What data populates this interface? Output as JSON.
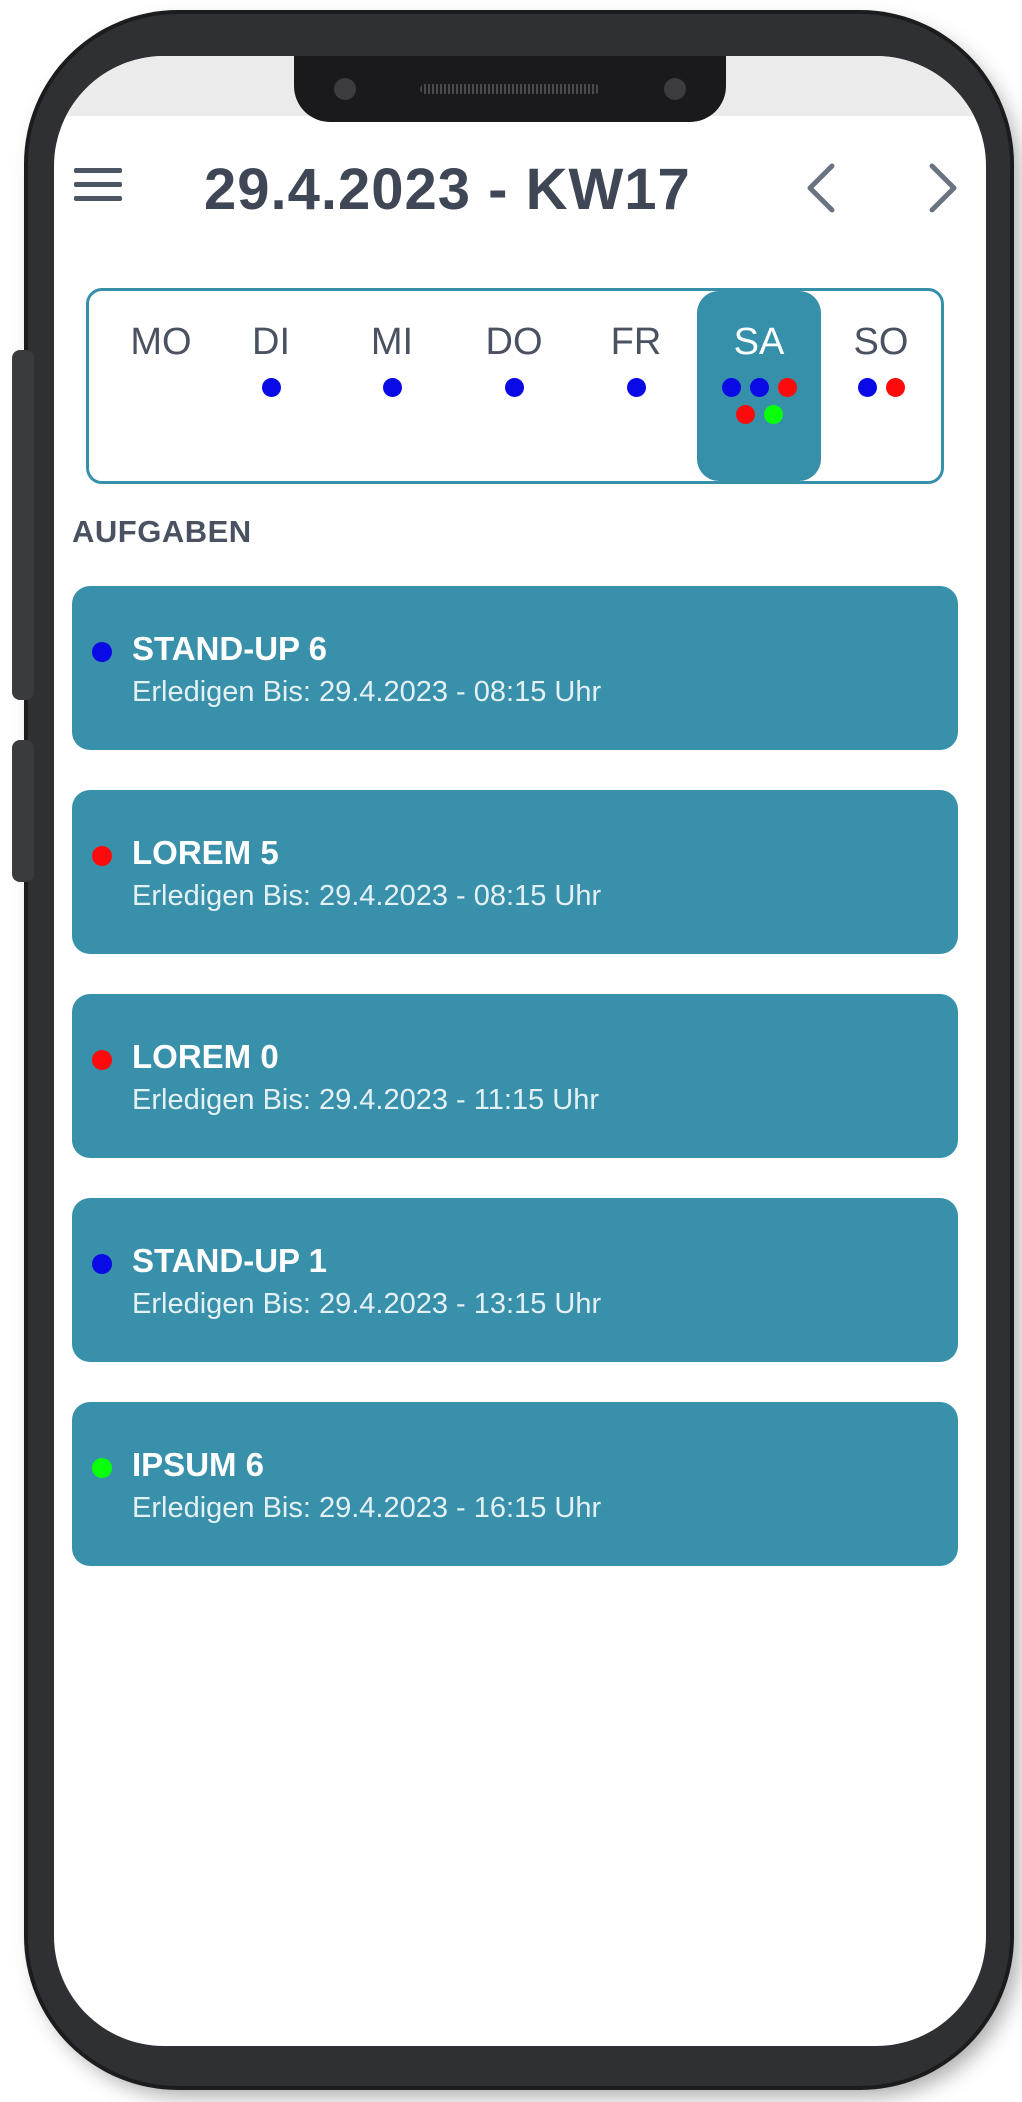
{
  "header": {
    "title": "29.4.2023 - KW17",
    "menu_icon": "hamburger-menu-icon",
    "prev_icon": "chevron-left-icon",
    "next_icon": "chevron-right-icon"
  },
  "week": {
    "selected": "SA",
    "days": [
      {
        "label": "MO",
        "dots": []
      },
      {
        "label": "DI",
        "dots": [
          "#0a0ae6"
        ]
      },
      {
        "label": "MI",
        "dots": [
          "#0a0ae6"
        ]
      },
      {
        "label": "DO",
        "dots": [
          "#0a0ae6"
        ]
      },
      {
        "label": "FR",
        "dots": [
          "#0a0ae6"
        ]
      },
      {
        "label": "SA",
        "dots": [
          "#0a0ae6",
          "#0a0ae6",
          "#ff0a0a",
          "#ff0a0a",
          "#0aff0a"
        ]
      },
      {
        "label": "SO",
        "dots": [
          "#0a0ae6",
          "#ff0a0a"
        ]
      }
    ]
  },
  "section_title": "AUFGABEN",
  "tasks": [
    {
      "name": "STAND-UP 6",
      "due": "Erledigen Bis: 29.4.2023 - 08:15 Uhr",
      "color": "#0a0ae6"
    },
    {
      "name": "LOREM 5",
      "due": "Erledigen Bis: 29.4.2023 - 08:15 Uhr",
      "color": "#ff0a0a"
    },
    {
      "name": "LOREM 0",
      "due": "Erledigen Bis: 29.4.2023 - 11:15 Uhr",
      "color": "#ff0a0a"
    },
    {
      "name": "STAND-UP 1",
      "due": "Erledigen Bis: 29.4.2023 - 13:15 Uhr",
      "color": "#0a0ae6"
    },
    {
      "name": "IPSUM 6",
      "due": "Erledigen Bis: 29.4.2023 - 16:15 Uhr",
      "color": "#0aff0a"
    }
  ],
  "colors": {
    "accent": "#3690aa",
    "text": "#3f4756"
  }
}
